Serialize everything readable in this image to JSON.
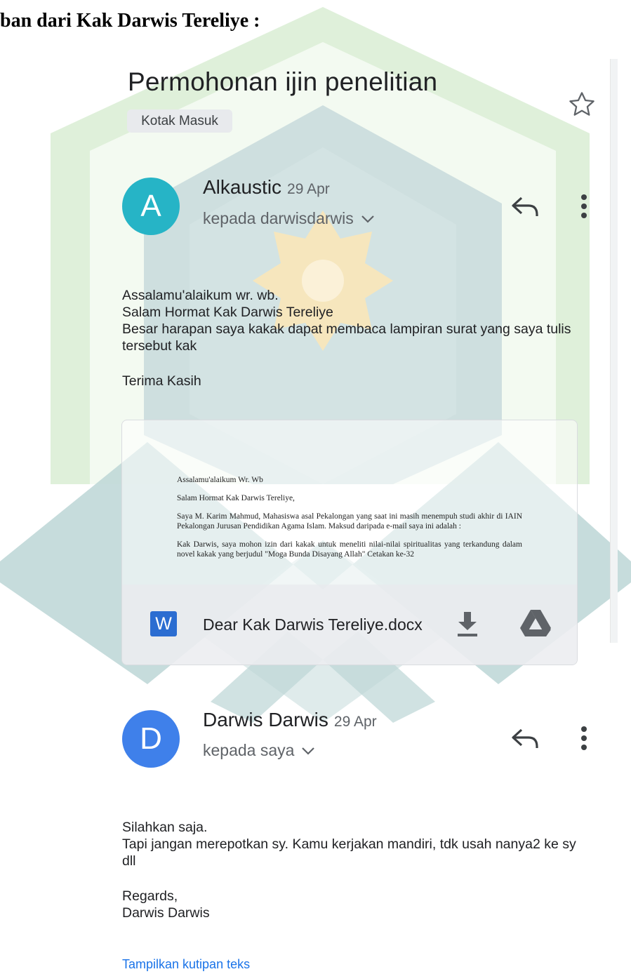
{
  "document_caption": "ban dari Kak Darwis Tereliye :",
  "email_thread": {
    "subject": "Permohonan ijin penelitian",
    "label": "Kotak Masuk",
    "messages": [
      {
        "avatar_letter": "A",
        "avatar_color": "#26b4c6",
        "sender": "Alkaustic",
        "date": "29 Apr",
        "recipient": "kepada darwisdarwis",
        "body": [
          "Assalamu'alaikum wr. wb.",
          "Salam Hormat Kak Darwis Tereliye",
          "Besar harapan saya kakak dapat membaca lampiran surat yang saya tulis tersebut kak",
          "",
          "Terima Kasih"
        ],
        "attachment": {
          "file_name": "Dear Kak Darwis Tereliye.docx",
          "file_icon": "W",
          "preview_lines": [
            "Assalamu'alaikum Wr. Wb",
            "Salam Hormat Kak Darwis Tereliye,",
            "Saya M. Karim Mahmud, Mahasiswa asal Pekalongan yang saat ini masih menempuh studi akhir di IAIN Pekalongan Jurusan Pendidikan Agama Islam. Maksud daripada e-mail saya ini adalah :",
            "Kak Darwis, saya mohon izin dari kakak untuk meneliti nilai-nilai spiritualitas yang terkandung dalam novel kakak yang berjudul \"Moga Bunda Disayang Allah\" Cetakan ke-32"
          ]
        }
      },
      {
        "avatar_letter": "D",
        "avatar_color": "#3f80ea",
        "sender": "Darwis Darwis",
        "date": "29 Apr",
        "recipient": "kepada saya",
        "body": [
          "Silahkan saja.",
          "Tapi jangan merepotkan sy. Kamu kerjakan mandiri, tdk usah nanya2 ke sy dll",
          "",
          "Regards,",
          "Darwis Darwis"
        ]
      }
    ],
    "show_quoted_text": "Tampilkan kutipan teks"
  },
  "icons": [
    "star-icon",
    "reply-icon",
    "more-vert-icon",
    "chevron-down-icon",
    "word-file-icon",
    "download-icon",
    "google-drive-icon"
  ],
  "colors": {
    "watermark_green": "#d6ecd0",
    "watermark_teal": "#c5d9da",
    "watermark_gold": "#f6e6bd",
    "link_blue": "#1a73e8"
  }
}
